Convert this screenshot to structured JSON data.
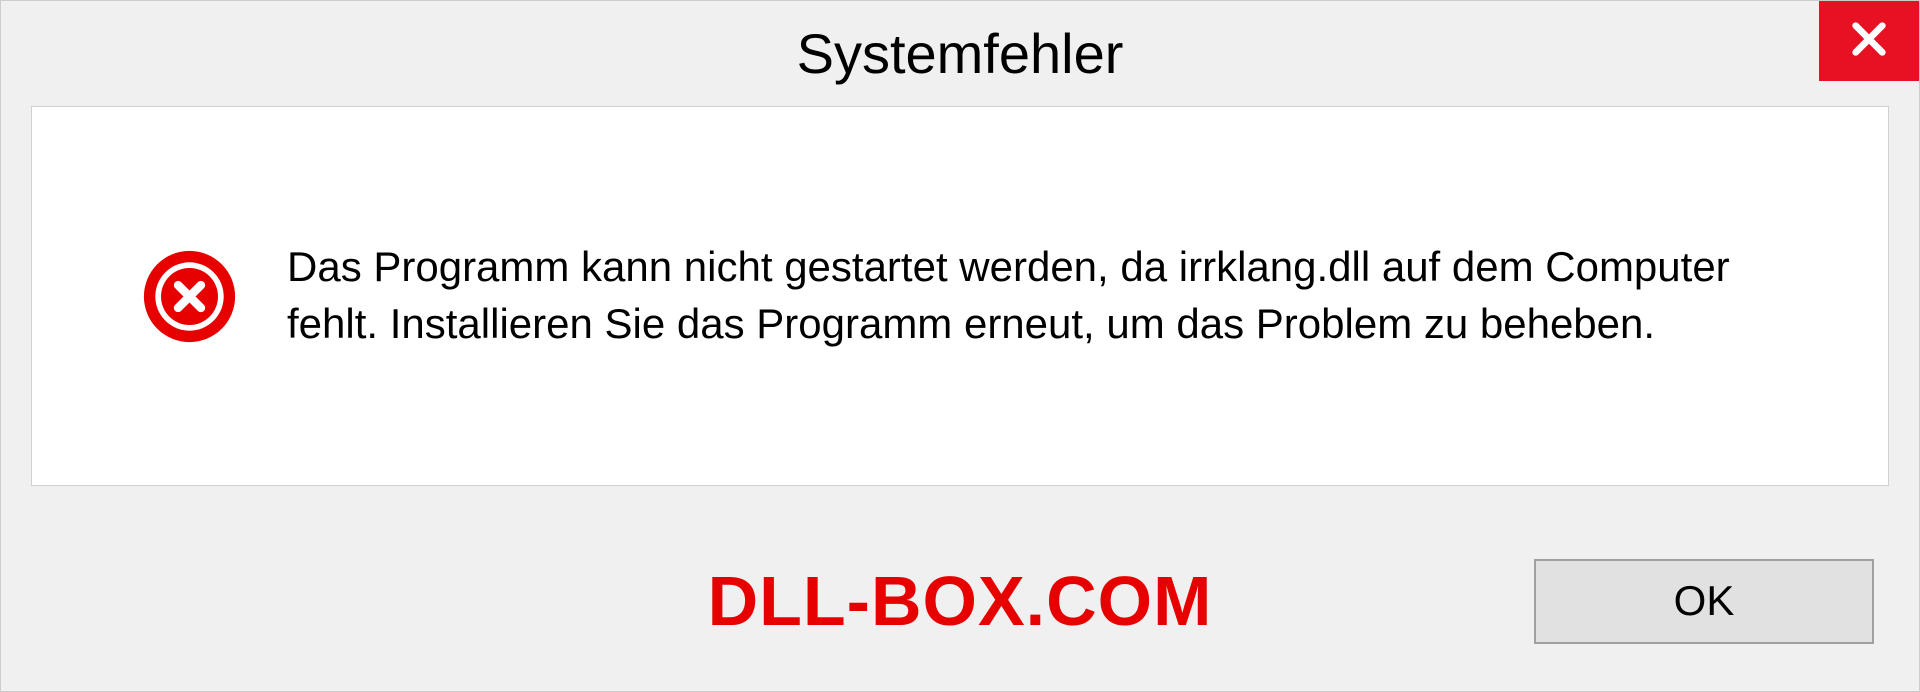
{
  "dialog": {
    "title": "Systemfehler",
    "message": "Das Programm kann nicht gestartet werden, da irrklang.dll auf dem Computer fehlt. Installieren Sie das Programm erneut, um das Problem zu beheben.",
    "ok_label": "OK"
  },
  "watermark": "DLL-BOX.COM"
}
